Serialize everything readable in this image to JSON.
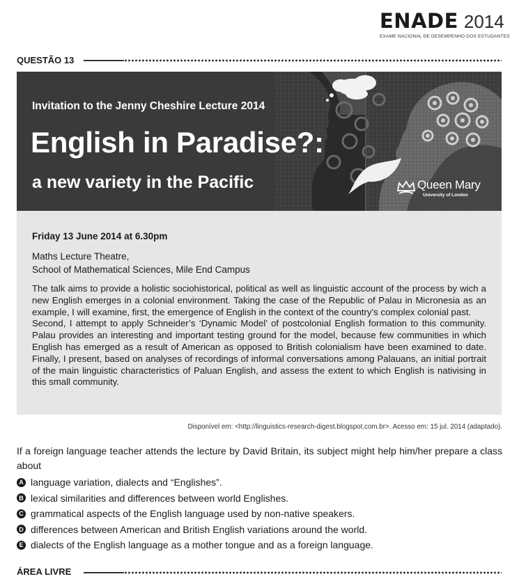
{
  "header": {
    "logo_word": "ENADE",
    "logo_year": "2014",
    "logo_subtitle": "EXAME NACIONAL DE DESEMPENHO DOS ESTUDANTES",
    "section_label": "QUESTÃO 13"
  },
  "banner": {
    "kicker": "Invitation to the Jenny Cheshire Lecture 2014",
    "title": "English in Paradise?:",
    "subtitle": "a new variety in the Pacific",
    "logo_name": "Queen Mary",
    "logo_university": "University of London",
    "icons": [
      "thought-cloud-icon",
      "gears-icon",
      "crown-icon",
      "head-silhouette-icon"
    ]
  },
  "event": {
    "date_time": "Friday 13 June 2014 at 6.30pm",
    "venue_line1": "Maths Lecture Theatre,",
    "venue_line2": "School of Mathematical Sciences, Mile End Campus",
    "abstract_p1": "The talk aims to provide a holistic sociohistorical, political as well as linguistic account of the process by wich a new English emerges in a colonial environment. Taking the case of the Republic of Palau in Micronesia as an example, I will examine, first, the emergence of English in the context of the country’s complex colonial past.",
    "abstract_p2": "Second, I attempt to apply Schneider’s ‘Dynamic Model’ of postcolonial English formation to this community. Palau provides an interesting and important testing ground for the model, because few communities in which English has emerged as a result of American as opposed to British colonialism have been examined to date. Finally, I present, based on analyses of recordings of informal conversations among Palauans, an initial portrait of the main linguistic characteristics of Paluan English, and assess the extent to which English is nativising in this small community."
  },
  "source": "Disponível em: <http://linguistics-research-digest.blogspot.com.br>. Acesso em: 15 jul. 2014 (adaptado).",
  "question": {
    "stem": "If a foreign language teacher attends the lecture by David Britain, its subject might help him/her prepare a class about",
    "options": [
      {
        "letter": "A",
        "text": "language variation, dialects and “Englishes”."
      },
      {
        "letter": "B",
        "text": "lexical similarities and differences between world Englishes."
      },
      {
        "letter": "C",
        "text": "grammatical aspects of the English language used by non-native speakers."
      },
      {
        "letter": "D",
        "text": "differences between American and British English variations around the world."
      },
      {
        "letter": "E",
        "text": "dialects of the English language as a mother tongue and as a foreign language."
      }
    ]
  },
  "footer": {
    "section_label": "ÁREA LIVRE"
  }
}
